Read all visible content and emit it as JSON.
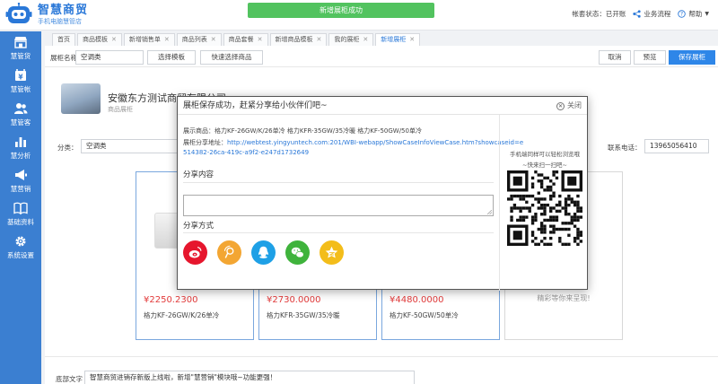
{
  "header": {
    "logo_title": "智慧商贸",
    "logo_sub": "手机电脑慧管店",
    "toast": "新增展柜成功",
    "status": "帐套状态：已开账",
    "process": "业务流程",
    "help": "帮助"
  },
  "sidebar": {
    "items": [
      {
        "label": "慧管货",
        "icon": "store-icon"
      },
      {
        "label": "慧管帐",
        "icon": "ledger-icon"
      },
      {
        "label": "慧管客",
        "icon": "users-icon"
      },
      {
        "label": "慧分析",
        "icon": "bar-chart-icon"
      },
      {
        "label": "慧营销",
        "icon": "megaphone-icon"
      },
      {
        "label": "基础资料",
        "icon": "book-icon"
      },
      {
        "label": "系统设置",
        "icon": "gear-icon"
      }
    ]
  },
  "tabs": [
    {
      "label": "首页",
      "closable": false
    },
    {
      "label": "商品模板",
      "closable": true
    },
    {
      "label": "新增销售单",
      "closable": true
    },
    {
      "label": "商品列表",
      "closable": true
    },
    {
      "label": "商品套餐",
      "closable": true
    },
    {
      "label": "新增商品模板",
      "closable": true
    },
    {
      "label": "我的展柜",
      "closable": true
    },
    {
      "label": "新增展柜",
      "closable": true,
      "active": true
    }
  ],
  "toolbar": {
    "name_label": "展柜名称",
    "name_value": "空调类",
    "select_template": "选择模板",
    "quick_select": "快速选择商品",
    "cancel": "取消",
    "preview": "预览",
    "save": "保存展柜"
  },
  "shop": {
    "name": "安徽东方测试商贸有限公司",
    "type": "商品展柜"
  },
  "filters": {
    "category_label": "分类：",
    "category_value": "空调类",
    "phone_label": "联系电话：",
    "phone_value": "13965056410"
  },
  "cards": [
    {
      "price": "¥2250.2300",
      "name": "格力KF-26GW/K/26单冷"
    },
    {
      "price": "¥2730.0000",
      "name": "格力KFR-35GW/35冷暖"
    },
    {
      "price": "¥4480.0000",
      "name": "格力KF-50GW/50单冷"
    }
  ],
  "empty_card": "精彩等你来呈现!",
  "footer": {
    "label": "底部文字",
    "value": "智慧商贸进销存新版上线啦，新增\"慧营销\"模块哦~功能更强！"
  },
  "modal": {
    "title": "展柜保存成功，赶紧分享给小伙伴们吧~",
    "close": "关闭",
    "products_label": "展示商品：",
    "products": "格力KF-26GW/K/26单冷 格力KFR-35GW/35冷暖 格力KF-50GW/50单冷",
    "link_label": "展柜分享地址：",
    "link_line1": "http://webtest.yingyuntech.com:201/WBI-webapp/ShowCaseInfoViewCase.htm?showcaseid=e",
    "link_line2": "514382-26ca-419c-a9f2-e247d1732649",
    "share_content": "分享内容",
    "share_method": "分享方式",
    "qr_tip1": "手机端同样可以轻松浏览哦",
    "qr_tip2": "~快来扫一扫吧~",
    "share_icons": [
      "weibo-icon",
      "tencent-weibo-icon",
      "qq-icon",
      "wechat-icon",
      "qzone-icon"
    ]
  },
  "colors": {
    "sidebar": "#3b7fd1",
    "primary": "#2e86e8",
    "toast": "#52c35f",
    "price": "#e23b3b",
    "weibo": "#e6162d",
    "tencent": "#f3a633",
    "qq": "#1ea0e6",
    "wechat": "#3fb33c",
    "qzone": "#f3bd1a"
  }
}
